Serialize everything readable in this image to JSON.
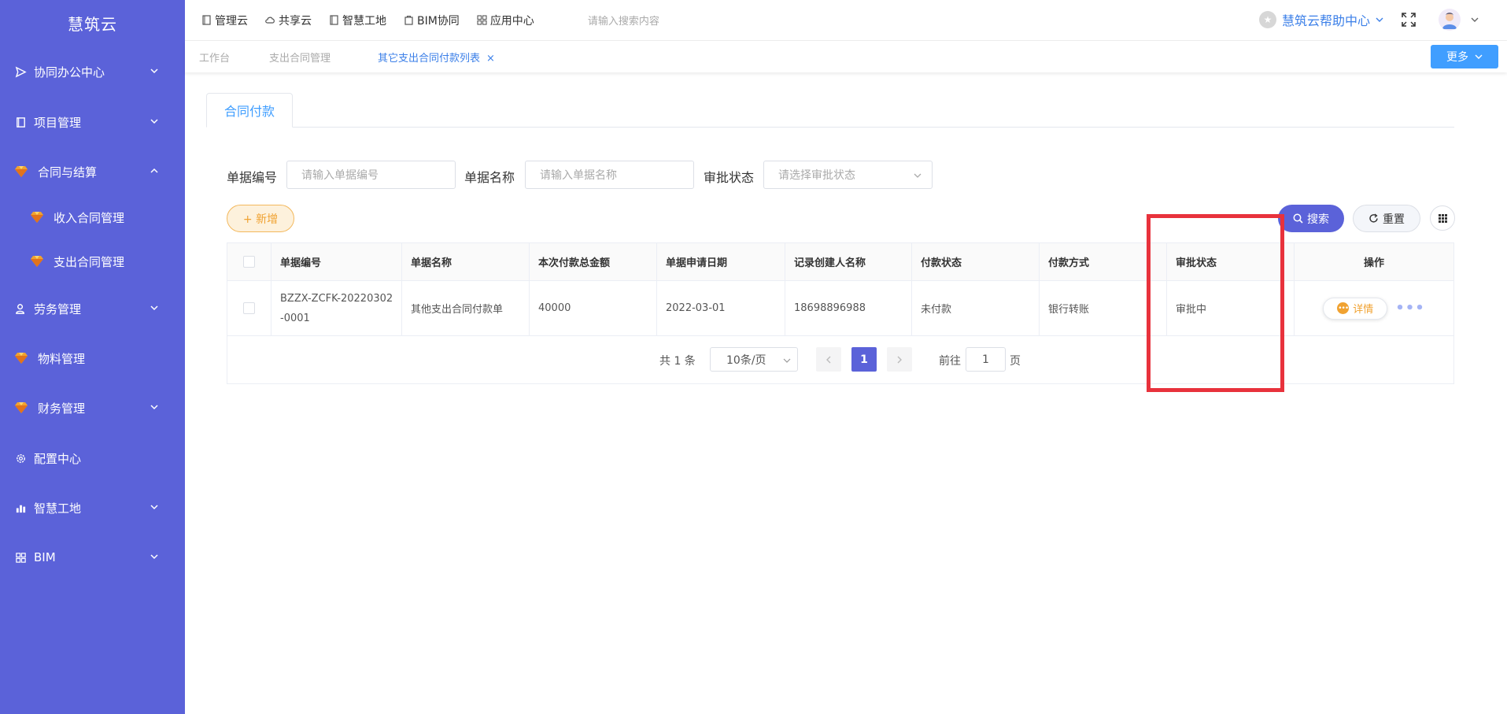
{
  "brand": "慧筑云",
  "sidebar": {
    "items": [
      {
        "label": "协同办公中心",
        "icon": "send-icon"
      },
      {
        "label": "项目管理",
        "icon": "book-icon"
      },
      {
        "label": "合同与结算",
        "icon": "gem-icon"
      },
      {
        "label": "收入合同管理",
        "icon": "gem-icon"
      },
      {
        "label": "支出合同管理",
        "icon": "gem-icon"
      },
      {
        "label": "劳务管理",
        "icon": "user-icon"
      },
      {
        "label": "物料管理",
        "icon": "gem-icon"
      },
      {
        "label": "财务管理",
        "icon": "gem-icon"
      },
      {
        "label": "配置中心",
        "icon": "gear-icon"
      },
      {
        "label": "智慧工地",
        "icon": "bar-chart-icon"
      },
      {
        "label": "BIM",
        "icon": "grid-icon"
      }
    ]
  },
  "header": {
    "nav": [
      "管理云",
      "共享云",
      "智慧工地",
      "BIM协同",
      "应用中心"
    ],
    "search_placeholder": "请输入搜索内容",
    "help": "慧筑云帮助中心"
  },
  "tabs": {
    "items": [
      "工作台",
      "支出合同管理",
      "其它支出合同付款列表"
    ],
    "close": "×",
    "more": "更多"
  },
  "section_tab": "合同付款",
  "filters": {
    "code_label": "单据编号",
    "code_placeholder": "请输入单据编号",
    "name_label": "单据名称",
    "name_placeholder": "请输入单据名称",
    "status_label": "审批状态",
    "status_placeholder": "请选择审批状态"
  },
  "buttons": {
    "add": "+ 新增",
    "search": "搜索",
    "reset": "重置"
  },
  "table": {
    "columns": [
      "单据编号",
      "单据名称",
      "本次付款总金额",
      "单据申请日期",
      "记录创建人名称",
      "付款状态",
      "付款方式",
      "审批状态",
      "操作"
    ],
    "rows": [
      {
        "code_line1": "BZZX-ZCFK-20220302",
        "code_line2": "-0001",
        "name": "其他支出合同付款单",
        "amount": "40000",
        "date": "2022-03-01",
        "creator": "18698896988",
        "pay_status": "未付款",
        "pay_method": "银行转账",
        "approval": "审批中",
        "action": "详情",
        "more": "•••"
      }
    ]
  },
  "pagination": {
    "total": "共 1 条",
    "page_size": "10条/页",
    "current": "1",
    "goto_prefix": "前往",
    "goto_value": "1",
    "goto_suffix": "页"
  },
  "colors": {
    "sidebar": "#5b62d9",
    "primary": "#409eff",
    "accent_orange": "#f0a231",
    "highlight": "#e8323c"
  }
}
